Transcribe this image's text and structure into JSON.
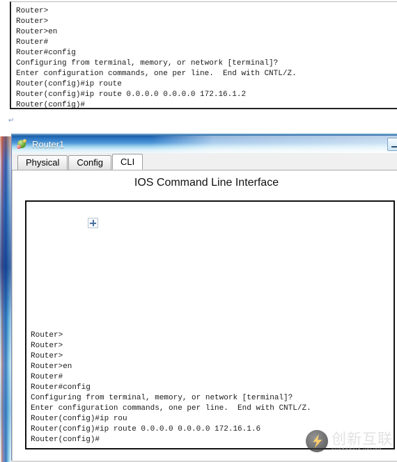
{
  "top_console": {
    "name": "document-terminal-output",
    "lines": [
      "Router>",
      "Router>",
      "Router>en",
      "Router#",
      "Router#config",
      "Configuring from terminal, memory, or network [terminal]?",
      "Enter configuration commands, one per line.  End with CNTL/Z.",
      "Router(config)#ip route",
      "Router(config)#ip route 0.0.0.0 0.0.0.0 172.16.1.2",
      "Router(config)#"
    ]
  },
  "pilcrow": "↵",
  "device_window": {
    "title": "Router1",
    "icon": "packet-tracer-router-icon",
    "buttons": {
      "minimize_label": "—"
    },
    "tabs": [
      {
        "label": "Physical",
        "active": false
      },
      {
        "label": "Config",
        "active": false
      },
      {
        "label": "CLI",
        "active": true
      }
    ],
    "heading": "IOS Command Line Interface",
    "broken_image_icon": "broken-image-placeholder-icon",
    "console_lines": [
      "Router>",
      "Router>",
      "Router>",
      "Router>en",
      "Router#",
      "Router#config",
      "Configuring from terminal, memory, or network [terminal]?",
      "Enter configuration commands, one per line.  End with CNTL/Z.",
      "Router(config)#ip rou",
      "Router(config)#ip route 0.0.0.0 0.0.0.0 172.16.1.6",
      "Router(config)#"
    ]
  },
  "watermark": {
    "text_cn": "创新互联",
    "text_sub": "CHUANGXIN HULIAN",
    "logo": "lightning-bolt-circle-logo"
  },
  "colors": {
    "titlebar_blue": "#2f79c4",
    "accent_yellow": "#f0a024",
    "console_text": "#1a1a1a"
  }
}
